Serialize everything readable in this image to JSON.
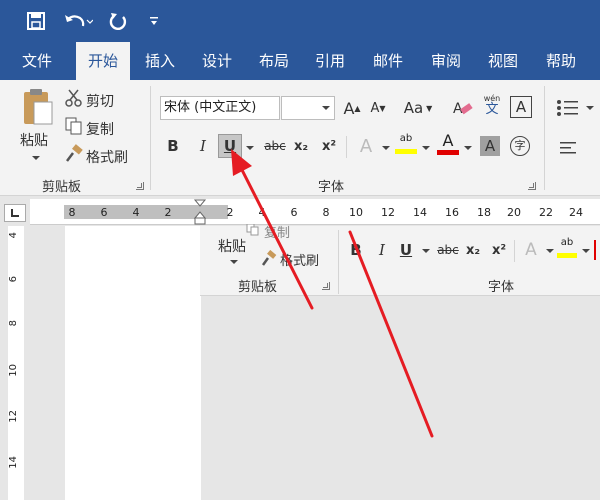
{
  "quick_access": {
    "save_icon": "save-icon",
    "undo_icon": "undo-icon",
    "redo_icon": "redo-icon",
    "customize_icon": "customize-icon"
  },
  "menu": {
    "tabs": [
      "文件",
      "开始",
      "插入",
      "设计",
      "布局",
      "引用",
      "邮件",
      "审阅",
      "视图",
      "帮助"
    ],
    "active_tab": "开始"
  },
  "clipboard": {
    "paste_label": "粘贴",
    "cut_label": "剪切",
    "copy_label": "复制",
    "format_painter_label": "格式刷",
    "group_label": "剪贴板"
  },
  "font": {
    "font_name": "宋体 (中文正文)",
    "font_size": "",
    "grow_label": "A",
    "shrink_label": "A",
    "case_label": "Aa",
    "phonetic_label": "wén",
    "phonetic_char": "文",
    "border_label": "A",
    "bold_label": "B",
    "italic_label": "I",
    "underline_label": "U",
    "strike_label": "abc",
    "subscript_label": "x₂",
    "superscript_label": "x²",
    "text_effect_label": "A",
    "highlight_label": "ab",
    "font_color_label": "A",
    "shading_label": "A",
    "enclose_label": "字",
    "group_label": "字体"
  },
  "ruler": {
    "h_labels": [
      "8",
      "6",
      "4",
      "2",
      "2",
      "4",
      "6",
      "8",
      "10",
      "12",
      "14",
      "16",
      "18",
      "20",
      "22",
      "24"
    ],
    "v_labels": [
      "4",
      "6",
      "8",
      "10",
      "12",
      "14"
    ]
  },
  "inset": {
    "copy_label": "复制",
    "paste_label": "粘贴",
    "format_painter_label": "格式刷",
    "clipboard_group_label": "剪贴板",
    "bold_label": "B",
    "italic_label": "I",
    "underline_label": "U",
    "strike_label": "abc",
    "subscript_label": "x₂",
    "superscript_label": "x²",
    "text_effect_label": "A",
    "highlight_label": "ab",
    "font_group_label": "字体"
  },
  "colors": {
    "title_bar": "#2b579a",
    "ribbon_bg": "#f3f3f3",
    "highlight_yellow": "#ffff00",
    "font_red": "#e00000",
    "arrow_red": "#e51c23"
  }
}
